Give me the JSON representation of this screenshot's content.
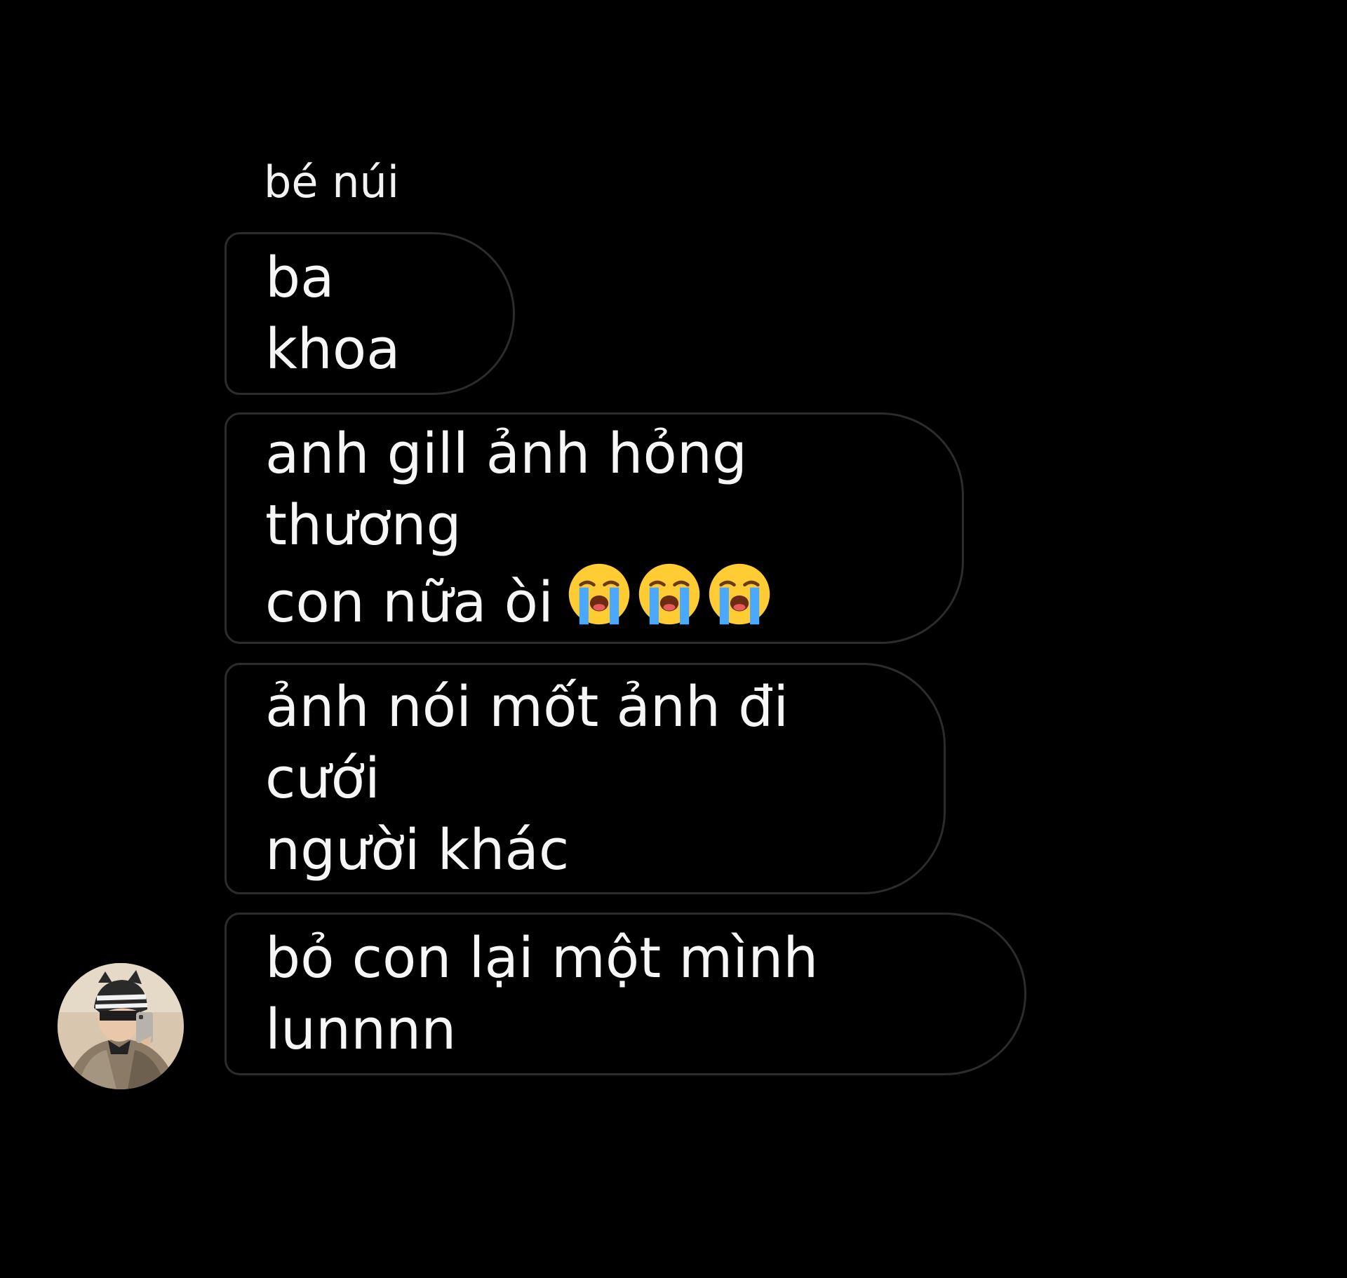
{
  "sender_name": "bé núi",
  "messages": [
    {
      "text": "ba khoa"
    },
    {
      "text": "anh gill ảnh hỏng thương\ncon nữa òi",
      "emojis": [
        "loudly-crying-face",
        "loudly-crying-face",
        "loudly-crying-face"
      ]
    },
    {
      "text": "ảnh nói mốt ảnh đi cưới\nngười khác"
    },
    {
      "text": "bỏ con lại một mình lunnnn"
    }
  ],
  "avatar": {
    "icon": "avatar"
  },
  "colors": {
    "background": "#000000",
    "bubble_border": "#2c2c2c",
    "text": "#f6f6f6"
  }
}
